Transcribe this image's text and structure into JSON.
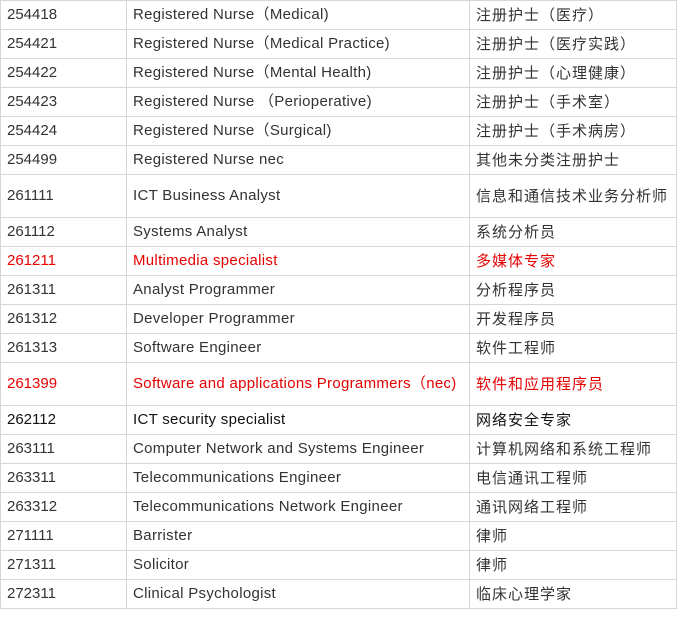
{
  "rows": [
    {
      "code": "254418",
      "en": "Registered Nurse（Medical)",
      "cn": "注册护士（医疗）",
      "style": ""
    },
    {
      "code": "254421",
      "en": "Registered Nurse（Medical  Practice)",
      "cn": "注册护士（医疗实践）",
      "style": ""
    },
    {
      "code": "254422",
      "en": "Registered Nurse（Mental  Health)",
      "cn": "注册护士（心理健康）",
      "style": ""
    },
    {
      "code": "254423",
      "en": "Registered Nurse （Perioperative)",
      "cn": "注册护士（手术室）",
      "style": ""
    },
    {
      "code": "254424",
      "en": "Registered Nurse（Surgical)",
      "cn": "注册护士（手术病房）",
      "style": ""
    },
    {
      "code": "254499",
      "en": "Registered Nurse nec",
      "cn": "其他未分类注册护士",
      "style": ""
    },
    {
      "code": "261111",
      "en": "ICT Business Analyst",
      "cn": "信息和通信技术业务分析师",
      "style": "tall"
    },
    {
      "code": "261112",
      "en": "Systems Analyst",
      "cn": "系统分析员",
      "style": ""
    },
    {
      "code": "261211",
      "en": "Multimedia specialist",
      "cn": "多媒体专家",
      "style": "hl"
    },
    {
      "code": "261311",
      "en": "Analyst Programmer",
      "cn": "分析程序员",
      "style": ""
    },
    {
      "code": "261312",
      "en": "Developer Programmer",
      "cn": "开发程序员",
      "style": ""
    },
    {
      "code": "261313",
      "en": "Software Engineer",
      "cn": "软件工程师",
      "style": ""
    },
    {
      "code": "261399",
      "en": "Software  and  applications     Programmers（nec)",
      "cn": "软件和应用程序员",
      "style": "hl tall"
    },
    {
      "code": "262112",
      "en": "ICT  security specialist",
      "cn": "网络安全专家",
      "style": "dark"
    },
    {
      "code": "263111",
      "en": "Computer Network and  Systems  Engineer",
      "cn": "计算机网络和系统工程师",
      "style": ""
    },
    {
      "code": "263311",
      "en": "Telecommunications  Engineer",
      "cn": "电信通讯工程师",
      "style": ""
    },
    {
      "code": "263312",
      "en": "Telecommunications  Network  Engineer",
      "cn": "通讯网络工程师",
      "style": ""
    },
    {
      "code": "271111",
      "en": "Barrister",
      "cn": "律师",
      "style": ""
    },
    {
      "code": "271311",
      "en": "Solicitor",
      "cn": "律师",
      "style": ""
    },
    {
      "code": "272311",
      "en": "Clinical Psychologist",
      "cn": "临床心理学家",
      "style": ""
    }
  ]
}
